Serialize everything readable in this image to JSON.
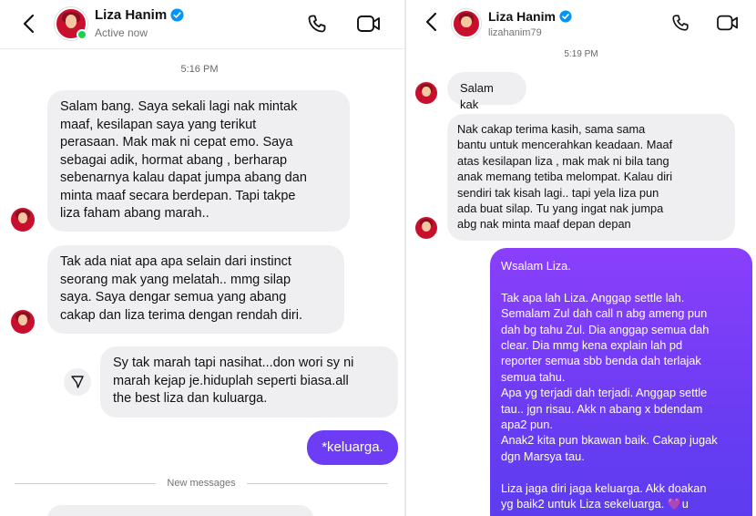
{
  "left": {
    "header": {
      "name": "Liza Hanim",
      "status": "Active now"
    },
    "timestamp": "5:16 PM",
    "messages": [
      {
        "text": "Salam bang. Saya sekali lagi nak mintak\nmaaf, kesilapan saya yang terikut\nperasaan. Mak mak ni cepat emo. Saya\nsebagai adik, hormat abang , berharap\nsebenarnya kalau dapat jumpa abang dan\nminta maaf secara berdepan. Tapi takpe\nliza faham abang marah.."
      },
      {
        "text": "Tak ada niat apa apa selain dari instinct\nseorang mak yang melatah.. mmg silap\nsaya. Saya dengar semua yang abang\ncakap dan liza terima dengan rendah diri."
      },
      {
        "text": "Sy tak marah tapi nasihat...don wori sy ni\nmarah kejap je.hiduplah seperti biasa.all\nthe best liza dan kuluarga."
      },
      {
        "text": "*keluarga."
      }
    ],
    "new_messages_label": "New messages"
  },
  "right": {
    "header": {
      "name": "Liza Hanim",
      "username": "lizahanim79"
    },
    "timestamp": "5:19 PM",
    "messages": [
      {
        "text": "Salam kak"
      },
      {
        "text": "Nak cakap terima kasih, sama sama\nbantu untuk mencerahkan keadaan. Maaf\natas kesilapan liza , mak mak ni bila tang\nanak memang tetiba melompat. Kalau diri\nsendiri tak kisah lagi.. tapi yela liza pun\nada buat silap. Tu yang ingat nak jumpa\nabg nak minta maaf depan depan"
      },
      {
        "text": "Wsalam Liza.\n\nTak apa lah Liza. Anggap settle lah.\nSemalam Zul dah call n abg ameng pun\ndah bg tahu Zul. Dia anggap semua dah\nclear. Dia mmg kena explain lah pd\nreporter semua sbb benda dah terlajak\nsemua tahu.\nApa yg terjadi dah terjadi. Anggap settle\ntau.. jgn risau. Akk n abang x bdendam\napa2 pun.\nAnak2 kita pun bkawan baik. Cakap jugak\ndgn Marsya tau.\n\nLiza jaga diri jaga keluarga. Akk doakan\nyg baik2 untuk Liza sekeluarga. 💜u"
      }
    ]
  },
  "colors": {
    "incoming_bubble": "#efeff1",
    "outgoing_bubble": "#6c3df5",
    "verified_badge": "#0095f6",
    "online": "#1cd14f"
  }
}
